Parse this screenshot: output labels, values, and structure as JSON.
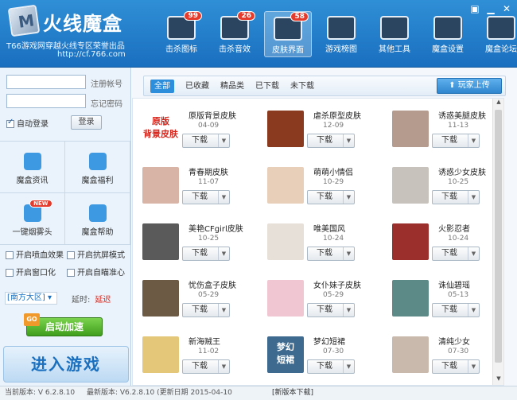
{
  "app": {
    "title": "火线魔盒",
    "subtitle": "T66游戏网穿越火线专区荣誉出品",
    "url": "http://cf.766.com",
    "logo_letter": "M",
    "window_buttons": [
      "▣",
      "▁",
      "✕"
    ]
  },
  "nav": [
    {
      "label": "击杀图标",
      "badge": "99",
      "icon": "kill-icon-icon"
    },
    {
      "label": "击杀音效",
      "badge": "26",
      "icon": "sound-icon"
    },
    {
      "label": "皮肤界面",
      "badge": "58",
      "icon": "skin-icon",
      "active": true
    },
    {
      "label": "游戏榜图",
      "badge": "",
      "icon": "chart-icon"
    },
    {
      "label": "其他工具",
      "badge": "",
      "icon": "tools-icon"
    },
    {
      "label": "魔盒设置",
      "badge": "",
      "icon": "settings-icon"
    },
    {
      "label": "魔盒论坛",
      "badge": "",
      "icon": "forum-icon"
    }
  ],
  "login": {
    "account_label": "注册帐号",
    "password_label": "忘记密码",
    "auto_login_label": "自动登录",
    "auto_login_checked": true,
    "login_button": "登录"
  },
  "tiles": [
    {
      "label": "魔盒资讯",
      "badge": ""
    },
    {
      "label": "魔盒福利",
      "badge": ""
    },
    {
      "label": "一键烟雾头",
      "badge": "NEW"
    },
    {
      "label": "魔盒帮助",
      "badge": ""
    }
  ],
  "options": [
    {
      "label": "开启喷血效果"
    },
    {
      "label": "开启抗屏模式"
    },
    {
      "label": "开启窗口化"
    },
    {
      "label": "开启自瞄准心"
    }
  ],
  "region": {
    "value": "[南方大区]",
    "delay_label": "延时:",
    "delay_value": "延迟"
  },
  "accel_button": {
    "label": "启动加速",
    "icon_text": "GO"
  },
  "enter_button": "进入游戏",
  "tabs": [
    "全部",
    "已收藏",
    "精品类",
    "已下载",
    "未下载"
  ],
  "upload_button": "玩家上传",
  "download_label": "下载",
  "skins": [
    {
      "name": "原版背景皮肤",
      "date": "04-09",
      "color": "#ffffff",
      "thumb_text": "原版\n背景皮肤"
    },
    {
      "name": "虐杀原型皮肤",
      "date": "12-09",
      "color": "#8a3a1e",
      "thumb_text": ""
    },
    {
      "name": "诱惑美腿皮肤",
      "date": "11-13",
      "color": "#b59a8e",
      "thumb_text": ""
    },
    {
      "name": "青春期皮肤",
      "date": "11-07",
      "color": "#d8b4a6",
      "thumb_text": ""
    },
    {
      "name": "萌萌小情侣",
      "date": "10-29",
      "color": "#e8cfb9",
      "thumb_text": ""
    },
    {
      "name": "诱惑少女皮肤",
      "date": "10-25",
      "color": "#c8c2bc",
      "thumb_text": ""
    },
    {
      "name": "美艳CFgirl皮肤",
      "date": "10-25",
      "color": "#5a5a5a",
      "thumb_text": ""
    },
    {
      "name": "唯美国风",
      "date": "10-24",
      "color": "#e6e0d8",
      "thumb_text": ""
    },
    {
      "name": "火影忍者",
      "date": "10-24",
      "color": "#9b2f2b",
      "thumb_text": ""
    },
    {
      "name": "忧伤盒子皮肤",
      "date": "05-29",
      "color": "#6d5a44",
      "thumb_text": ""
    },
    {
      "name": "女仆妹子皮肤",
      "date": "05-29",
      "color": "#f0c6d2",
      "thumb_text": ""
    },
    {
      "name": "诛仙碧瑶",
      "date": "05-13",
      "color": "#5c8a86",
      "thumb_text": ""
    },
    {
      "name": "新海贼王",
      "date": "11-02",
      "color": "#e5c77a",
      "thumb_text": ""
    },
    {
      "name": "梦幻短裙",
      "date": "07-30",
      "color": "#3e6a8f",
      "thumb_text": "梦幻\n短裙"
    },
    {
      "name": "清纯少女",
      "date": "07-30",
      "color": "#c9b8ac",
      "thumb_text": ""
    }
  ],
  "status": {
    "current_version": "当前版本: V 6.2.8.10",
    "latest_version": "最新版本: V6.2.8.10 (更新日期 2015-04-10",
    "new_version": "[新版本下载]"
  },
  "colors": {
    "header": "#2f8fd6",
    "accent": "#2d8fdc",
    "delay": "#d9261c"
  }
}
